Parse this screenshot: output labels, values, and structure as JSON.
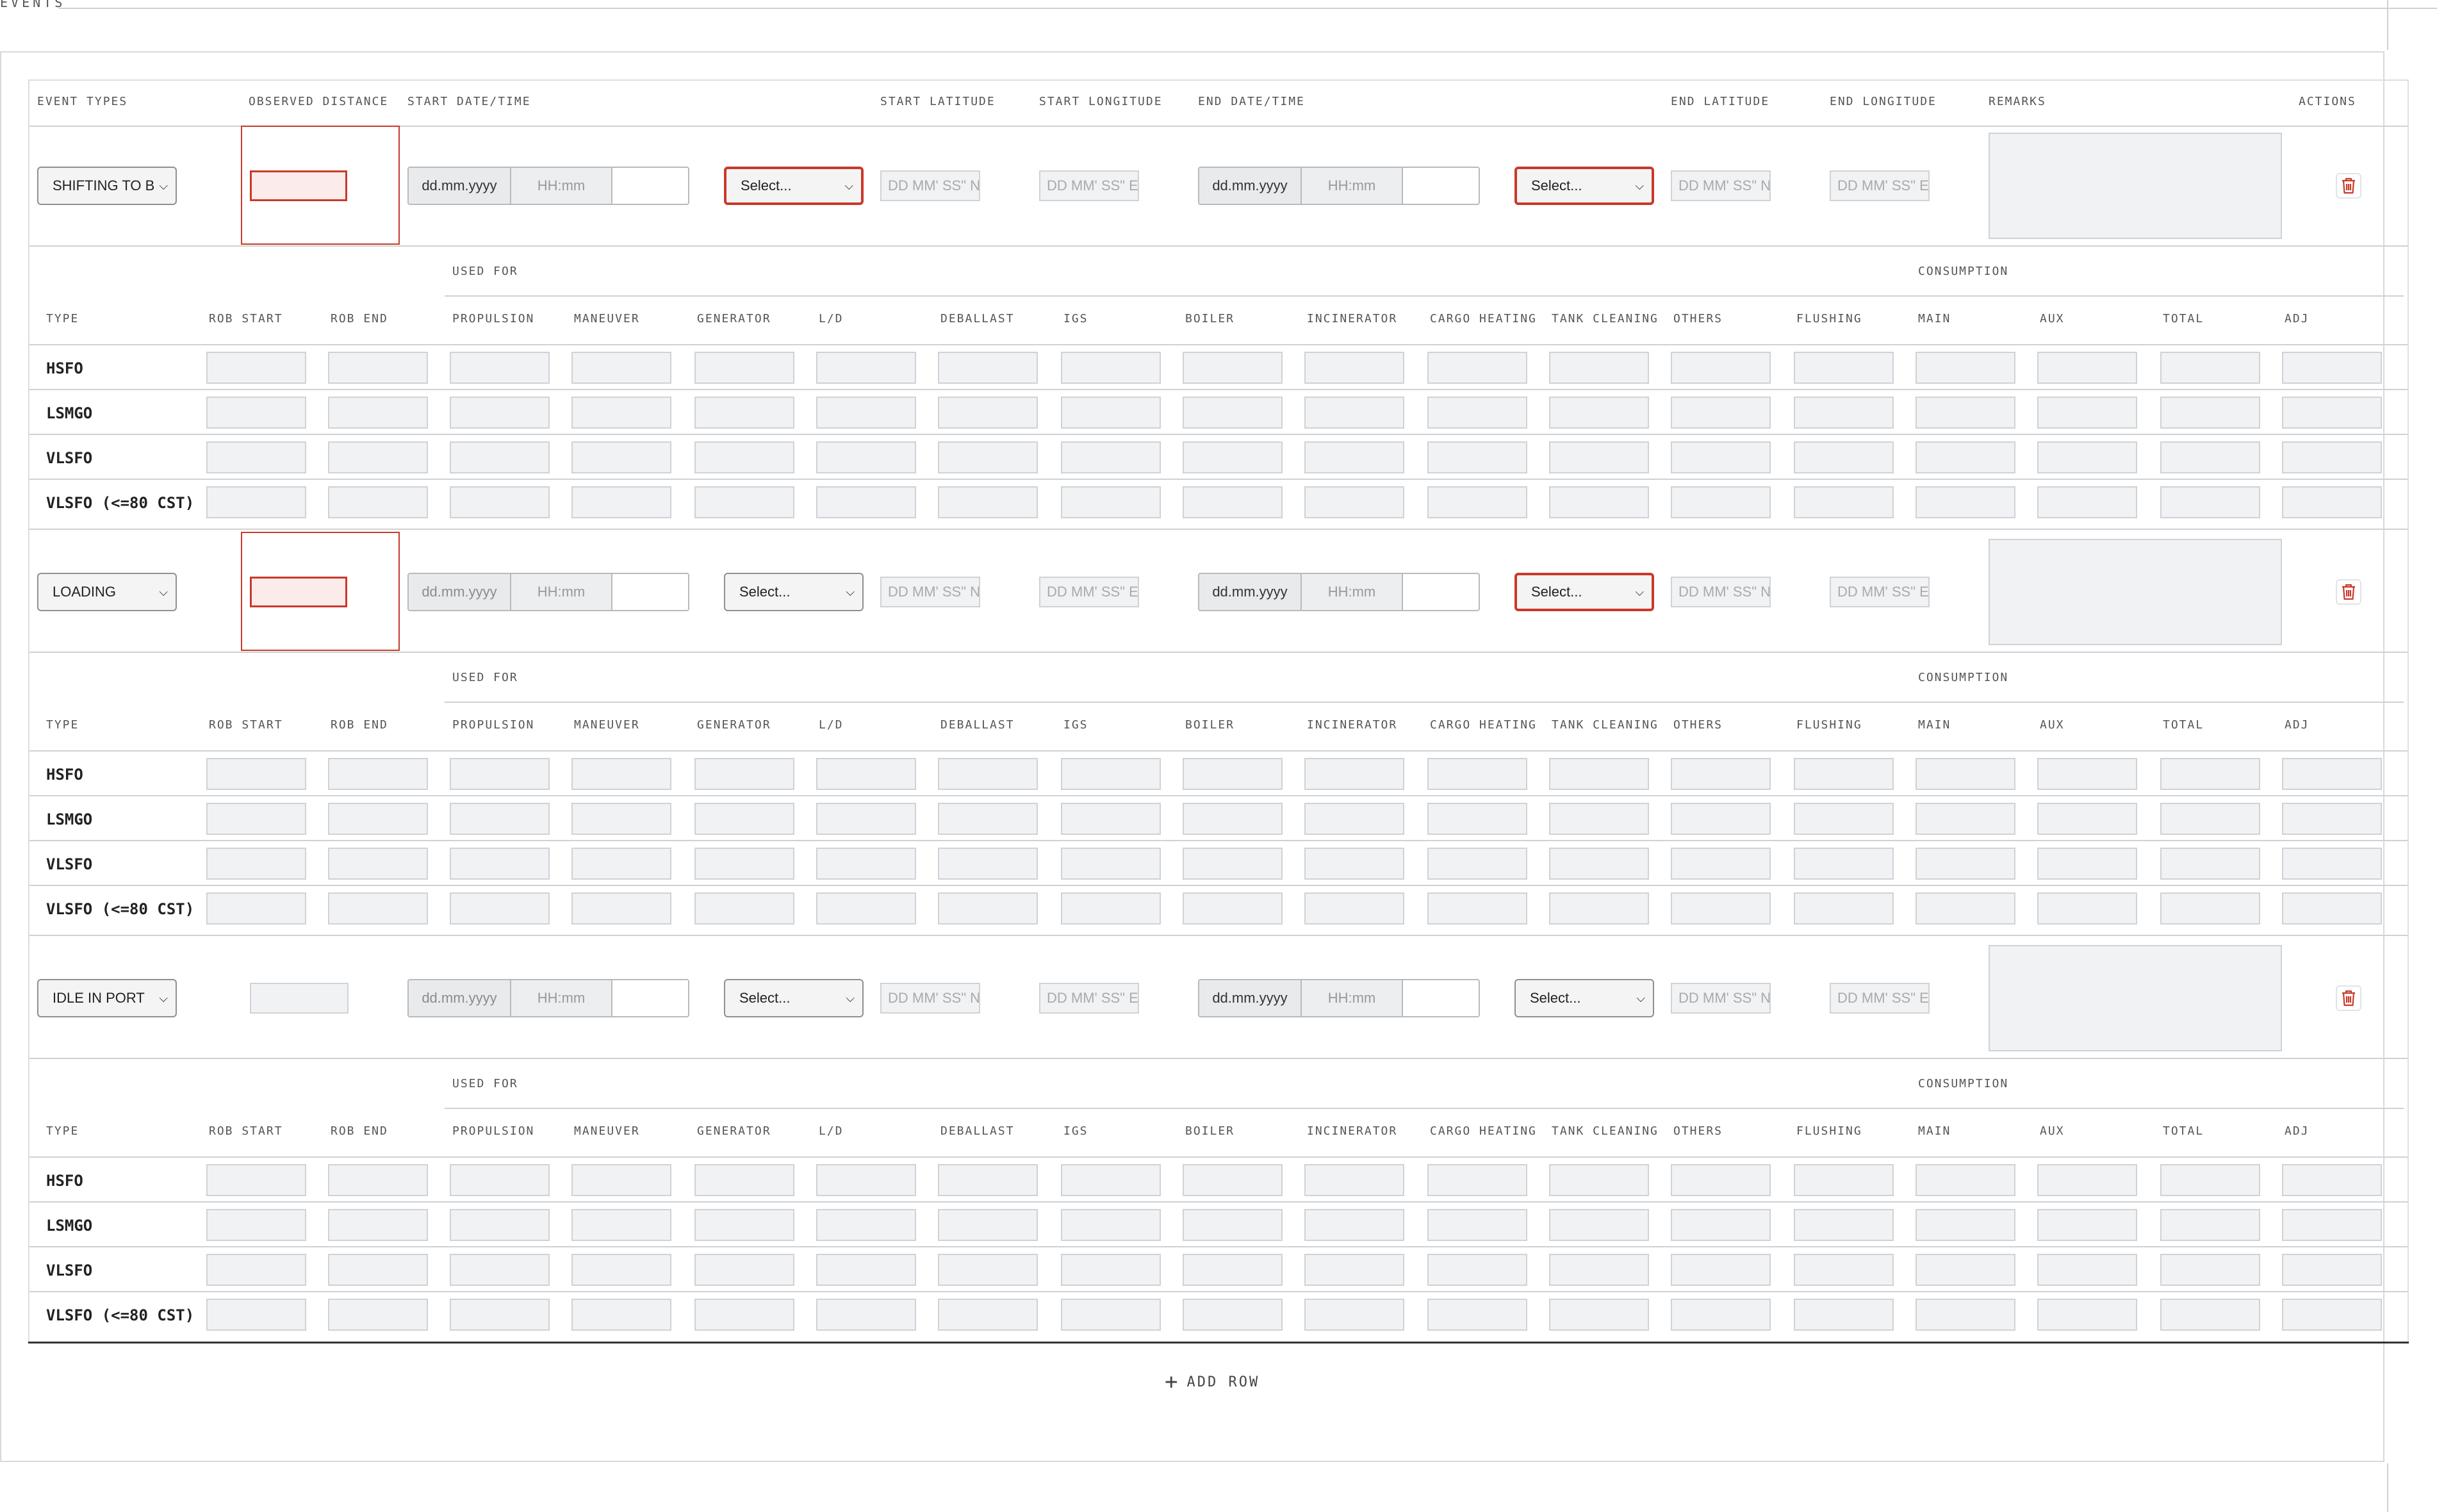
{
  "section": {
    "title": "EVENTS"
  },
  "columns": {
    "event_types": "EVENT TYPES",
    "observed_distance": "OBSERVED DISTANCE",
    "start_datetime": "START DATE/TIME",
    "start_latitude": "START LATITUDE",
    "start_longitude": "START LONGITUDE",
    "end_datetime": "END DATE/TIME",
    "end_latitude": "END LATITUDE",
    "end_longitude": "END LONGITUDE",
    "remarks": "REMARKS",
    "actions": "ACTIONS"
  },
  "placeholders": {
    "date": "dd.mm.yyyy",
    "time": "HH:mm",
    "select": "Select...",
    "lat": "DD MM' SS\" N",
    "lon": "DD MM' SS\" E"
  },
  "fuel_headers": {
    "used_for": "USED FOR",
    "consumption": "CONSUMPTION",
    "cols": [
      "TYPE",
      "ROB START",
      "ROB END",
      "PROPULSION",
      "MANEUVER",
      "GENERATOR",
      "L/D",
      "DEBALLAST",
      "IGS",
      "BOILER",
      "INCINERATOR",
      "CARGO HEATING",
      "TANK CLEANING",
      "OTHERS",
      "FLUSHING",
      "MAIN",
      "AUX",
      "TOTAL",
      "ADJ"
    ]
  },
  "fuel_types": [
    "HSFO",
    "LSMGO",
    "VLSFO",
    "VLSFO (<=80 CST)"
  ],
  "events": [
    {
      "type": "SHIFTING TO B",
      "observed_error": true,
      "start_port_error": true,
      "end_port_error": true
    },
    {
      "type": "LOADING",
      "observed_error": true,
      "start_port_error": false,
      "end_port_error": true
    },
    {
      "type": "IDLE IN PORT",
      "observed_error": false,
      "start_port_error": false,
      "end_port_error": false
    }
  ],
  "add_row": "ADD ROW",
  "colors": {
    "error": "#c83a2a",
    "border": "#cfd2d6",
    "field_bg": "#f1f2f4"
  }
}
